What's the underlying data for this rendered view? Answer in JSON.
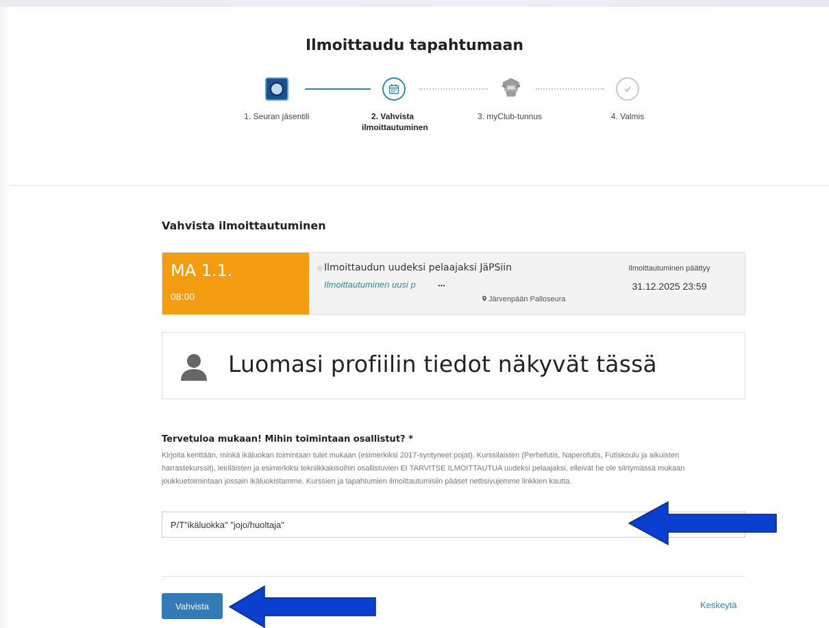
{
  "page": {
    "title": "Ilmoittaudu tapahtumaan"
  },
  "stepper": {
    "steps": [
      {
        "label": "1. Seuran jäsentili",
        "state": "completed",
        "icon": "club-logo-icon"
      },
      {
        "label": "2. Vahvista ilmoittautuminen",
        "state": "active",
        "icon": "calendar-icon"
      },
      {
        "label": "3. myClub-tunnus",
        "state": "pending",
        "icon": "myclub-logo-icon"
      },
      {
        "label": "4. Valmis",
        "state": "pending",
        "icon": "check-icon"
      }
    ]
  },
  "section": {
    "title": "Vahvista ilmoittautuminen"
  },
  "event": {
    "day": "MA 1.1.",
    "time": "08:00",
    "name": "Ilmoittaudun uudeksi pelaajaksi JäPSiin",
    "link_text": "Ilmoittautuminen uusi p",
    "link_ellipsis": "...",
    "location": "Järvenpään Palloseura",
    "deadline_label": "Ilmoittautuminen päättyy",
    "deadline_value": "31.12.2025 23:59"
  },
  "profile": {
    "placeholder_text": "Luomasi profiilin tiedot näkyvät tässä"
  },
  "question": {
    "label": "Tervetuloa mukaan! Mihin toimintaan osallistut? *",
    "help": "Kirjoita kenttään, minkä ikäluokan toimintaan tulet mukaan (esimerkiksi 2017-syntyneet pojat). Kurssilaisten (Perhefutis, Naperofutis, Futiskoulu ja aikuisten harrastekurssit), leiriläisten ja esimerkiksi tekniikkakisoihin osallistuvien EI TARVITSE ILMOITTAUTUA uudeksi pelaajaksi, elleivät he ole siirtymässä mukaan joukkuetoimintaan jossain ikäluokistamme. Kurssien ja tapahtumien ilmoittautumisiin pääset nettisivujemme linkkien kautta.",
    "value": "P/T\"ikäluokka\" \"jojo/huoltaja\""
  },
  "actions": {
    "confirm_label": "Vahvista",
    "cancel_label": "Keskeytä"
  },
  "colors": {
    "accent": "#2a8aa6",
    "event_orange": "#f39c12",
    "button_blue": "#337ab7",
    "annotation_arrow": "#0a3fd0"
  }
}
